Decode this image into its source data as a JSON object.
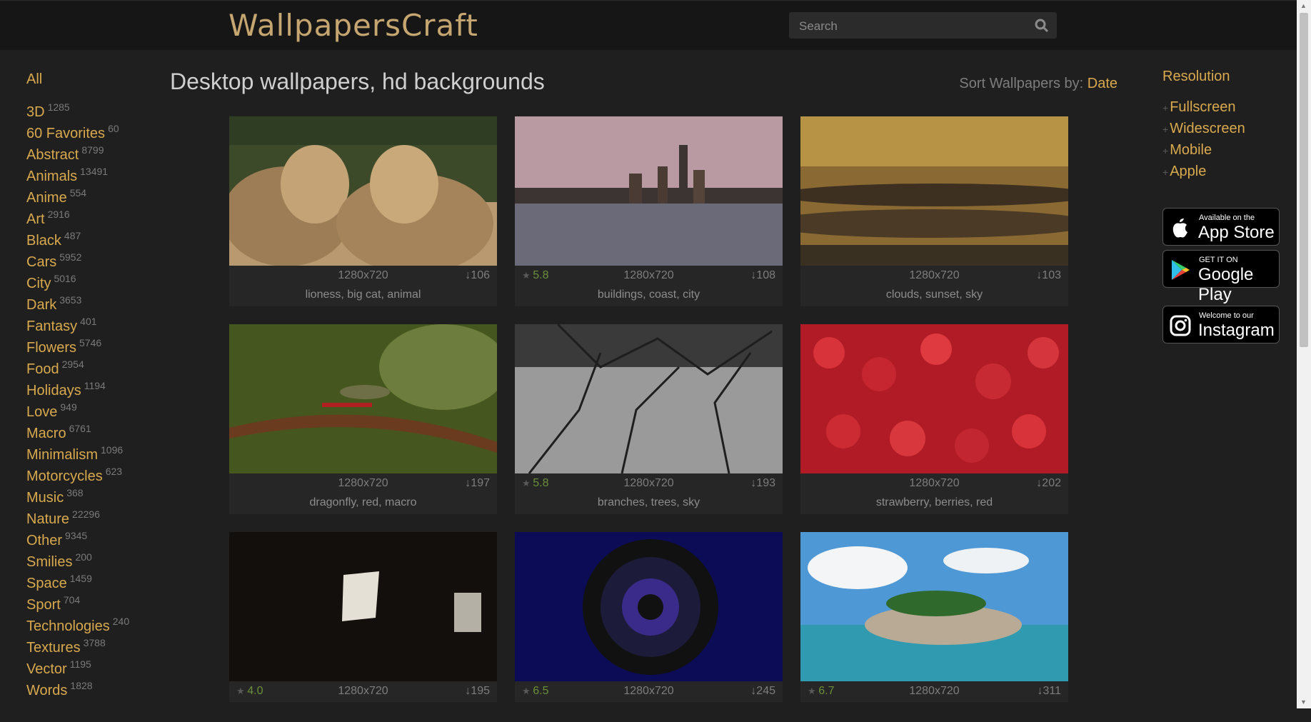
{
  "header": {
    "logo": "WallpapersCraft",
    "search_placeholder": "Search"
  },
  "sidebar": {
    "all_label": "All",
    "categories": [
      {
        "label": "3D",
        "count": "1285"
      },
      {
        "label": "60 Favorites",
        "count": "60"
      },
      {
        "label": "Abstract",
        "count": "8799"
      },
      {
        "label": "Animals",
        "count": "13491"
      },
      {
        "label": "Anime",
        "count": "554"
      },
      {
        "label": "Art",
        "count": "2916"
      },
      {
        "label": "Black",
        "count": "487"
      },
      {
        "label": "Cars",
        "count": "5952"
      },
      {
        "label": "City",
        "count": "5016"
      },
      {
        "label": "Dark",
        "count": "3653"
      },
      {
        "label": "Fantasy",
        "count": "401"
      },
      {
        "label": "Flowers",
        "count": "5746"
      },
      {
        "label": "Food",
        "count": "2954"
      },
      {
        "label": "Holidays",
        "count": "1194"
      },
      {
        "label": "Love",
        "count": "949"
      },
      {
        "label": "Macro",
        "count": "6761"
      },
      {
        "label": "Minimalism",
        "count": "1096"
      },
      {
        "label": "Motorcycles",
        "count": "623"
      },
      {
        "label": "Music",
        "count": "368"
      },
      {
        "label": "Nature",
        "count": "22296"
      },
      {
        "label": "Other",
        "count": "9345"
      },
      {
        "label": "Smilies",
        "count": "200"
      },
      {
        "label": "Space",
        "count": "1459"
      },
      {
        "label": "Sport",
        "count": "704"
      },
      {
        "label": "Technologies",
        "count": "240"
      },
      {
        "label": "Textures",
        "count": "3788"
      },
      {
        "label": "Vector",
        "count": "1195"
      },
      {
        "label": "Words",
        "count": "1828"
      }
    ]
  },
  "main": {
    "title": "Desktop wallpapers, hd backgrounds",
    "sort_label": "Sort Wallpapers by:",
    "sort_value": "Date",
    "wallpapers": [
      {
        "rating": "",
        "resolution": "1280x720",
        "downloads": "106",
        "tags": "lioness, big cat, animal",
        "image": "lions"
      },
      {
        "rating": "5.8",
        "resolution": "1280x720",
        "downloads": "108",
        "tags": "buildings, coast, city",
        "image": "city"
      },
      {
        "rating": "",
        "resolution": "1280x720",
        "downloads": "103",
        "tags": "clouds, sunset, sky",
        "image": "clouds"
      },
      {
        "rating": "",
        "resolution": "1280x720",
        "downloads": "197",
        "tags": "dragonfly, red, macro",
        "image": "dragonfly"
      },
      {
        "rating": "5.8",
        "resolution": "1280x720",
        "downloads": "193",
        "tags": "branches, trees, sky",
        "image": "branches"
      },
      {
        "rating": "",
        "resolution": "1280x720",
        "downloads": "202",
        "tags": "strawberry, berries, red",
        "image": "strawberries"
      },
      {
        "rating": "4.0",
        "resolution": "1280x720",
        "downloads": "195",
        "tags": "",
        "image": "dark-window"
      },
      {
        "rating": "6.5",
        "resolution": "1280x720",
        "downloads": "245",
        "tags": "",
        "image": "camera-lens"
      },
      {
        "rating": "6.7",
        "resolution": "1280x720",
        "downloads": "311",
        "tags": "",
        "image": "island"
      }
    ]
  },
  "right": {
    "resolution_title": "Resolution",
    "resolution_items": [
      "Fullscreen",
      "Widescreen",
      "Mobile",
      "Apple"
    ],
    "appstore_small": "Available on the",
    "appstore_big": "App Store",
    "googleplay_small": "GET IT ON",
    "googleplay_big": "Google Play",
    "instagram_small": "Welcome to our",
    "instagram_big": "Instagram"
  },
  "colors": {
    "accent": "#d9a94e",
    "background": "#1f1f1f",
    "header": "#161616",
    "rating": "#6b8f3a"
  }
}
